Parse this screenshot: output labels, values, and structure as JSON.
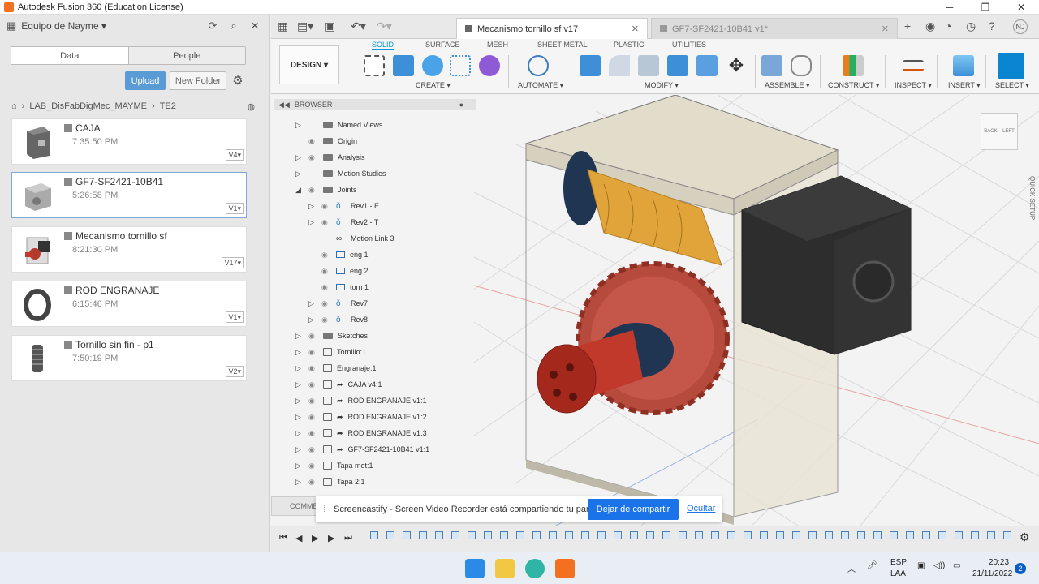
{
  "window": {
    "title": "Autodesk Fusion 360 (Education License)",
    "minimize": "─",
    "restore": "❐",
    "close": "✕"
  },
  "data_panel": {
    "team": "Equipo de Nayme",
    "tabs": [
      "Data",
      "People"
    ],
    "upload_label": "Upload",
    "new_folder_label": "New Folder",
    "breadcrumb": [
      "LAB_DisFabDigMec_MAYME",
      "TE2"
    ],
    "files": [
      {
        "name": "CAJA",
        "time": "7:35:50 PM",
        "version": "V4"
      },
      {
        "name": "GF7-SF2421-10B41",
        "time": "5:26:58 PM",
        "version": "V1"
      },
      {
        "name": "Mecanismo tornillo sf",
        "time": "8:21:30 PM",
        "version": "V17"
      },
      {
        "name": "ROD ENGRANAJE",
        "time": "6:15:46 PM",
        "version": "V1"
      },
      {
        "name": "Tornillo sin fin - p1",
        "time": "7:50:19 PM",
        "version": "V2"
      }
    ]
  },
  "doc_tabs": [
    {
      "label": "Mecanismo tornillo sf v17",
      "close": "✕"
    },
    {
      "label": "GF7-SF2421-10B41 v1*",
      "close": "✕"
    }
  ],
  "toolbar": {
    "workspace": "DESIGN ▾",
    "tabs": [
      "SOLID",
      "SURFACE",
      "MESH",
      "SHEET METAL",
      "PLASTIC",
      "UTILITIES"
    ],
    "groups": [
      "CREATE ▾",
      "AUTOMATE ▾",
      "MODIFY ▾",
      "ASSEMBLE ▾",
      "CONSTRUCT ▾",
      "INSPECT ▾",
      "INSERT ▾",
      "SELECT ▾"
    ]
  },
  "browser": {
    "title": "BROWSER",
    "items": [
      "Named Views",
      "Origin",
      "Analysis",
      "Motion Studies",
      "Joints",
      "Rev1 - E",
      "Rev2 - T",
      "Motion Link 3",
      "eng 1",
      "eng 2",
      "torn 1",
      "Rev7",
      "Rev8",
      "Sketches",
      "Tornillo:1",
      "Engranaje:1",
      "CAJA v4:1",
      "ROD ENGRANAJE v1:1",
      "ROD ENGRANAJE v1:2",
      "ROD ENGRANAJE v1:3",
      "GF7-SF2421-10B41 v1:1",
      "Tapa mot:1",
      "Tapa 2:1"
    ]
  },
  "viewcube": {
    "back": "BACK",
    "left": "LEFT"
  },
  "quick_setup": "QUICK SETUP",
  "comments_label": "COMME",
  "notification": {
    "message": "Screencastify - Screen Video Recorder está compartiendo tu pantalla.",
    "stop_label": "Dejar de compartir",
    "hide_label": "Ocultar"
  },
  "taskbar": {
    "lang1": "ESP",
    "lang2": "LAA",
    "time": "20:23",
    "date": "21/11/2022",
    "notif_count": "2"
  },
  "colors": {
    "accent": "#0696d7",
    "upload": "#5b9bd5",
    "fusion": "#f37021"
  }
}
